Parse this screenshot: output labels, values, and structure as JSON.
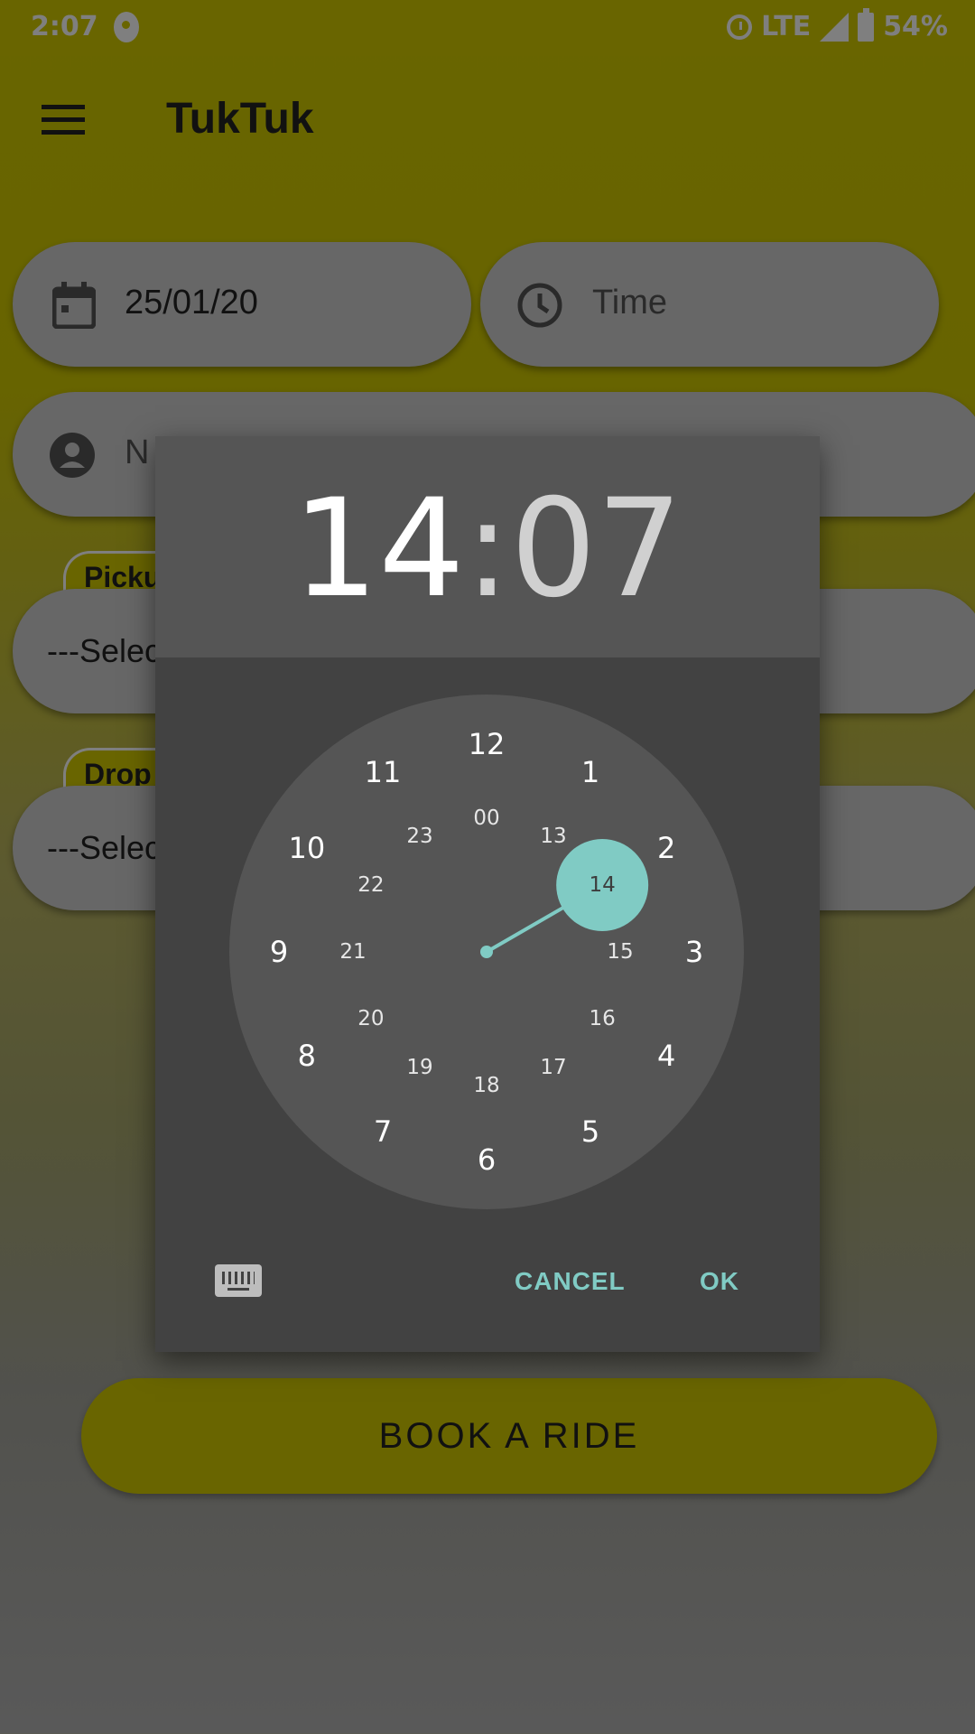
{
  "status_bar": {
    "time": "2:07",
    "network": "LTE",
    "battery": "54%"
  },
  "app": {
    "title": "TukTuk"
  },
  "form": {
    "date_value": "25/01/20",
    "time_placeholder": "Time",
    "name_placeholder": "N",
    "pickup_label": "Picku",
    "pickup_select": "---Selec",
    "drop_label": "Drop",
    "drop_select": "---Selec",
    "book_button": "BOOK A RIDE"
  },
  "time_picker": {
    "hour": "14",
    "separator": ":",
    "minute": "07",
    "selected_hour": 14,
    "outer_hours": [
      "12",
      "1",
      "2",
      "3",
      "4",
      "5",
      "6",
      "7",
      "8",
      "9",
      "10",
      "11"
    ],
    "inner_hours": [
      "00",
      "13",
      "14",
      "15",
      "16",
      "17",
      "18",
      "19",
      "20",
      "21",
      "22",
      "23"
    ],
    "cancel_label": "CANCEL",
    "ok_label": "OK",
    "accent_color": "#80cbc4"
  }
}
